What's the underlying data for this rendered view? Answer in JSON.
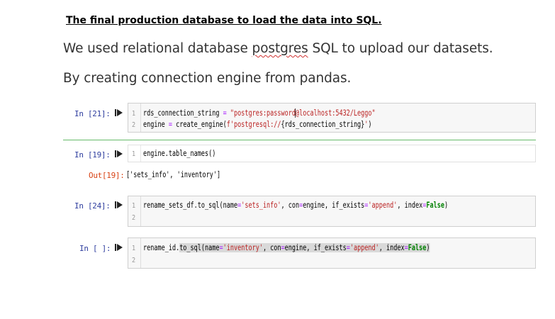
{
  "heading": "The final production database to load the data into SQL.",
  "paragraphs": {
    "p1_before": "We used relational database ",
    "p1_squiggle": "postgres",
    "p1_after": " SQL to upload our datasets.",
    "p2": "By creating connection engine from pandas."
  },
  "cells": [
    {
      "prompt": "In [21]:",
      "line_numbers": [
        "1",
        "2"
      ],
      "line1": {
        "a": "rds_connection_string ",
        "eq": "=",
        "s1": " \"postgres:password",
        "s2": "@localhost:5432/Leggo\""
      },
      "line2": {
        "a": "engine ",
        "eq": "=",
        "b": " create_engine(",
        "s": "f'postgresql://",
        "c": "{rds_connection_string}",
        "s2": "'",
        "d": ")"
      }
    },
    {
      "prompt": "In [19]:",
      "line_numbers": [
        "1"
      ],
      "line1": {
        "a": "engine.table_names()"
      },
      "out_prompt": "Out[19]:",
      "output": "['sets_info', 'inventory']"
    },
    {
      "prompt": "In [24]:",
      "line_numbers": [
        "1",
        "2"
      ],
      "line1": {
        "a": "rename_sets_df.to_sql(name",
        "eq1": "=",
        "s1": "'sets_info'",
        "b": ", con",
        "eq2": "=",
        "c": "engine, if_exists",
        "eq3": "=",
        "s2": "'append'",
        "d": ", index",
        "eq4": "=",
        "kw": "False",
        "e": ")"
      }
    },
    {
      "prompt": "In [ ]:",
      "line_numbers": [
        "1",
        "2"
      ],
      "line1": {
        "a": "rename_id.",
        "b": "to_sql(name",
        "eq1": "=",
        "s1": "'inventory'",
        "c": ", con",
        "eq2": "=",
        "d": "engine, if_exists",
        "eq3": "=",
        "s2": "'append'",
        "e": ", index",
        "eq4": "=",
        "kw": "False",
        "f": ")"
      }
    }
  ],
  "colors": {
    "in_prompt": "#303f9f",
    "out_prompt": "#d84315",
    "string": "#ba2121",
    "keyword": "#008000",
    "operator": "#aa22ff",
    "selected_cell_bar": "#42a5f5"
  },
  "icons": {
    "run": "run-cell-icon"
  }
}
